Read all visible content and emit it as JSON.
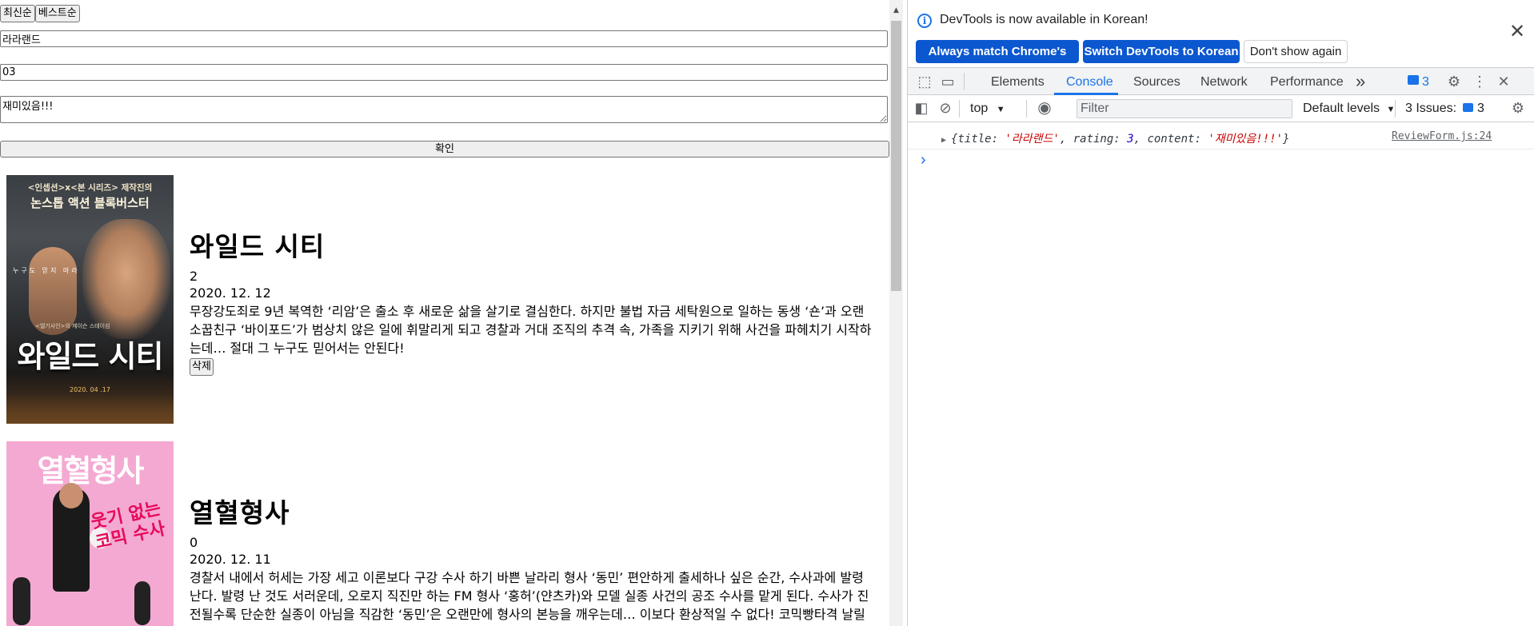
{
  "page": {
    "sort": {
      "latest_label": "최신순",
      "best_label": "베스트순"
    },
    "form": {
      "title_value": "라라랜드",
      "rating_value": "03",
      "content_value": "재미있음!!!",
      "submit_label": "확인"
    },
    "movies": [
      {
        "title": "와일드 시티",
        "rating": "2",
        "date": "2020. 12. 12",
        "description": "무장강도죄로 9년 복역한 ‘리암’은 출소 후 새로운 삶을 살기로 결심한다. 하지만 불법 자금 세탁원으로 일하는 동생 ‘숀’과 오랜 소꿉친구 ‘바이포드’가 범상치 않은 일에 휘말리게 되고 경찰과 거대 조직의 추격 속, 가족을 지키기 위해 사건을 파헤치기 시작하는데… 절대 그 누구도 믿어서는 안된다!",
        "delete_label": "삭제",
        "poster": {
          "tagline": "<인셉션>x<본 시리즈> 제작진의",
          "headline": "논스톱 액션 블록버스터",
          "side_text": "누구도 믿지 마라",
          "credits": "<엘기사인>의 제이슨 스테이섬",
          "big_title": "와일드 시티",
          "date": "2020. 04 .17"
        }
      },
      {
        "title": "열혈형사",
        "rating": "0",
        "date": "2020. 12. 11",
        "description": "경찰서 내에서 허세는 가장 세고 이론보다 구강 수사 하기 바쁜 날라리 형사 ‘동민’ 편안하게 출세하나 싶은 순간, 수사과에 발령 난다. 발령 난 것도 서러운데, 오로지 직진만 하는 FM 형사 ‘홍허’(얀츠카)와 모델 실종 사건의 공조 수사를 맡게 된다. 수사가 진전될수록 단순한 실종이 아님을 직감한 ‘동민’은 오랜만에 형사의 본능을 깨우는데… 이보다 환상적일 수 없다! 코믹빵타격 날릴 콤비 수사가 시작된다!",
        "poster": {
          "big_title": "열혈형사",
          "slogan": "웃기 없는 코믹 수사"
        }
      }
    ]
  },
  "devtools": {
    "banner": {
      "message": "DevTools is now available in Korean!",
      "match_label": "Always match Chrome's language",
      "switch_label": "Switch DevTools to Korean",
      "dismiss_label": "Don't show again"
    },
    "tabs": [
      "Elements",
      "Console",
      "Sources",
      "Network",
      "Performance"
    ],
    "active_tab": "Console",
    "more_tabs": "»",
    "issues_badge_count": "3",
    "toolbar": {
      "context": "top",
      "filter_placeholder": "Filter",
      "levels": "Default levels",
      "issues_label": "3 Issues:",
      "issues_count": "3"
    },
    "console": {
      "log_object_prefix": "{title: ",
      "log_title_value": "'라라랜드'",
      "log_rating_text": ", rating: ",
      "log_rating_value": "3",
      "log_content_text": ", content: ",
      "log_content_value": "'재미있음!!!'",
      "log_suffix": "}",
      "source": "ReviewForm.js:24",
      "prompt": "›"
    }
  },
  "colors": {
    "accent": "#1a73e8",
    "primary_button": "#0b57d0",
    "string_red": "#c80000",
    "poster_pink": "#f2a6cf"
  }
}
